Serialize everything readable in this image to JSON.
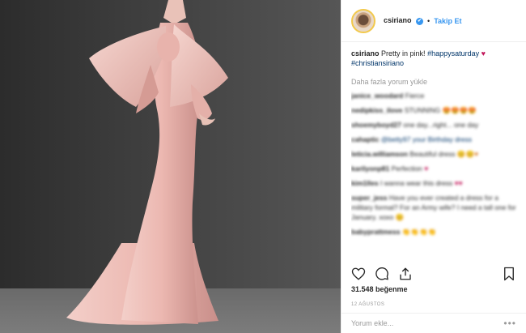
{
  "post": {
    "author": {
      "username": "csiriano",
      "verified_mark": "✔",
      "follow_label": "Takip Et",
      "dot": "•"
    },
    "caption": {
      "username": "csiriano",
      "text": "Pretty in pink!",
      "hashtag1": "#happysaturday",
      "emoji": "♥",
      "hashtag2": "#christiansiriano"
    },
    "load_more_label": "Daha fazla yorum yükle",
    "comments": [
      {
        "username": "janice_woodard",
        "text": "Fierce",
        "emoji": ""
      },
      {
        "username": "nedipkiss_ilove",
        "text": "STUNNING",
        "emoji": "😍😍😍😍"
      },
      {
        "username": "shoemyboyd27",
        "text": "one day...right... one day",
        "emoji": ""
      },
      {
        "username": "cahaptic",
        "text": "@betty97 your Birthday dress",
        "emoji": ""
      },
      {
        "username": "leticia.williamson",
        "text": "Beautiful dress",
        "emoji": "😊😊♥"
      },
      {
        "username": "karilyonp81",
        "text": "Perfection",
        "emoji": "♥"
      },
      {
        "username": "kim1lles",
        "text": "I wanna wear this dress",
        "emoji": "♥♥"
      },
      {
        "username": "super_jess",
        "text": "Have you ever created a dress for a military formal? For an Army wife? I need a tall one for January. xoxo",
        "emoji": "😊"
      },
      {
        "username": "babyprattmess",
        "text": "",
        "emoji": "👏👏👏👏"
      }
    ],
    "likes_label": "31.548 beğenme",
    "date_label": "12 AĞUSTOS",
    "comment_placeholder": "Yorum ekle...",
    "more_label": "•••"
  },
  "icons": [
    "heart-icon",
    "comment-icon",
    "share-icon",
    "bookmark-icon"
  ],
  "colors": {
    "link": "#3897f0",
    "text": "#262626",
    "muted": "#999999",
    "dress": "#eebfba"
  }
}
